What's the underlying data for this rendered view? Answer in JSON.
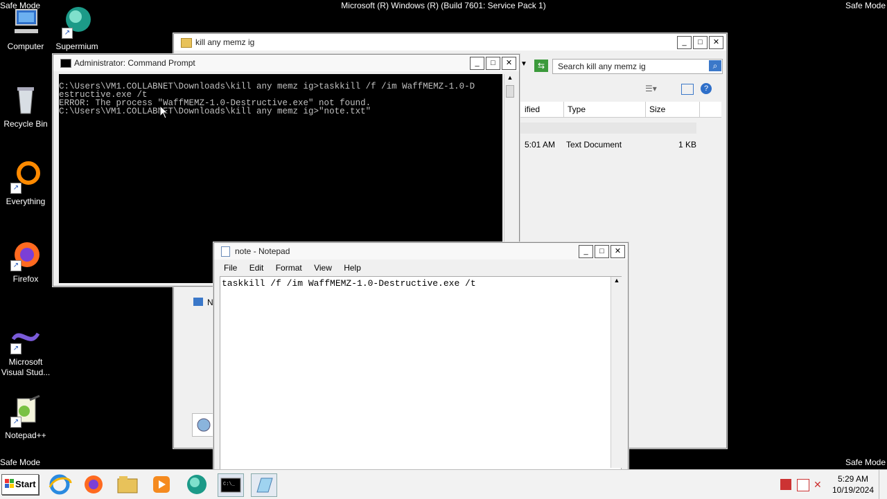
{
  "desktop": {
    "safe_mode_label": "Safe Mode",
    "build_text": "Microsoft (R) Windows (R) (Build 7601: Service Pack 1)",
    "icons": [
      {
        "label": "Computer",
        "icon": "computer-icon"
      },
      {
        "label": "Supermium",
        "icon": "supermium-icon"
      },
      {
        "label": "Recycle Bin",
        "icon": "recycle-bin-icon"
      },
      {
        "label": "Everything",
        "icon": "everything-icon"
      },
      {
        "label": "Firefox",
        "icon": "firefox-icon"
      },
      {
        "label": "Microsoft Visual Stud...",
        "icon": "visual-studio-icon"
      },
      {
        "label": "Notepad++",
        "icon": "notepadpp-icon"
      }
    ]
  },
  "explorer": {
    "title": "kill any memz ig",
    "search_placeholder": "Search kill any memz ig",
    "columns": [
      "ified",
      "Type",
      "Size"
    ],
    "rows": [
      {
        "modified": "5:01 AM",
        "type": "Text Document",
        "size": "1 KB"
      }
    ],
    "nav_partial": "N"
  },
  "cmd": {
    "title": "Administrator: Command Prompt",
    "lines": [
      "C:\\Users\\VM1.COLLABNET\\Downloads\\kill any memz ig>taskkill /f /im WaffMEMZ-1.0-D",
      "estructive.exe /t",
      "ERROR: The process \"WaffMEMZ-1.0-Destructive.exe\" not found.",
      "",
      "C:\\Users\\VM1.COLLABNET\\Downloads\\kill any memz ig>\"note.txt\""
    ]
  },
  "notepad": {
    "title": "note - Notepad",
    "menu": [
      "File",
      "Edit",
      "Format",
      "View",
      "Help"
    ],
    "content": "taskkill /f /im WaffMEMZ-1.0-Destructive.exe /t"
  },
  "taskbar": {
    "start_label": "Start",
    "time": "5:29 AM",
    "date": "10/19/2024",
    "apps": [
      "internet-explorer-icon",
      "firefox-icon",
      "explorer-icon",
      "media-player-icon",
      "supermium-icon",
      "cmd-icon",
      "notepad-icon"
    ]
  },
  "window_buttons": {
    "minimize": "_",
    "maximize": "□",
    "close": "✕"
  }
}
